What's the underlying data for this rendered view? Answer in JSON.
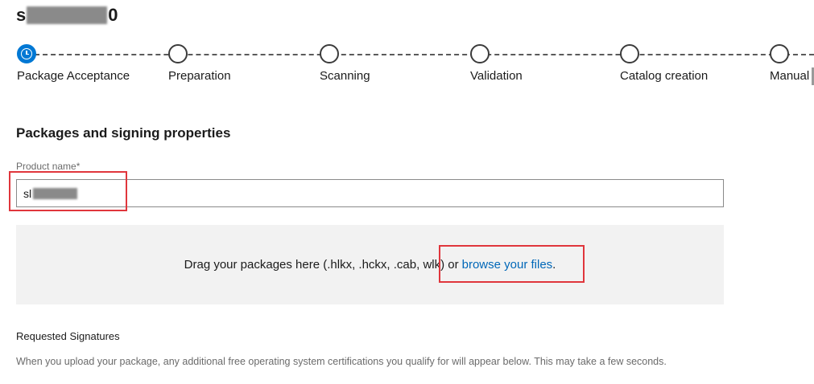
{
  "submission": {
    "title_start": "s",
    "title_end": "0"
  },
  "steps": [
    {
      "label": "Package Acceptance",
      "state": "active",
      "icon": "clock-icon"
    },
    {
      "label": "Preparation",
      "state": "pending"
    },
    {
      "label": "Scanning",
      "state": "pending"
    },
    {
      "label": "Validation",
      "state": "pending"
    },
    {
      "label": "Catalog creation",
      "state": "pending"
    },
    {
      "label": "Manual",
      "state": "pending"
    }
  ],
  "section_title": "Packages and signing properties",
  "product_name": {
    "label": "Product name",
    "required_mark": "*",
    "value": "sl"
  },
  "dropzone": {
    "text": "Drag your packages here (.hlkx, .hckx, .cab, wlk) or",
    "link": "browse your files",
    "suffix": "."
  },
  "requested_signatures": {
    "title": "Requested Signatures",
    "description": "When you upload your package, any additional free operating system certifications you qualify for will appear below. This may take a few seconds."
  },
  "colors": {
    "accent": "#0078d4",
    "link": "#0067b8",
    "highlight": "#e0363c",
    "dropzone_bg": "#f2f2f2"
  }
}
